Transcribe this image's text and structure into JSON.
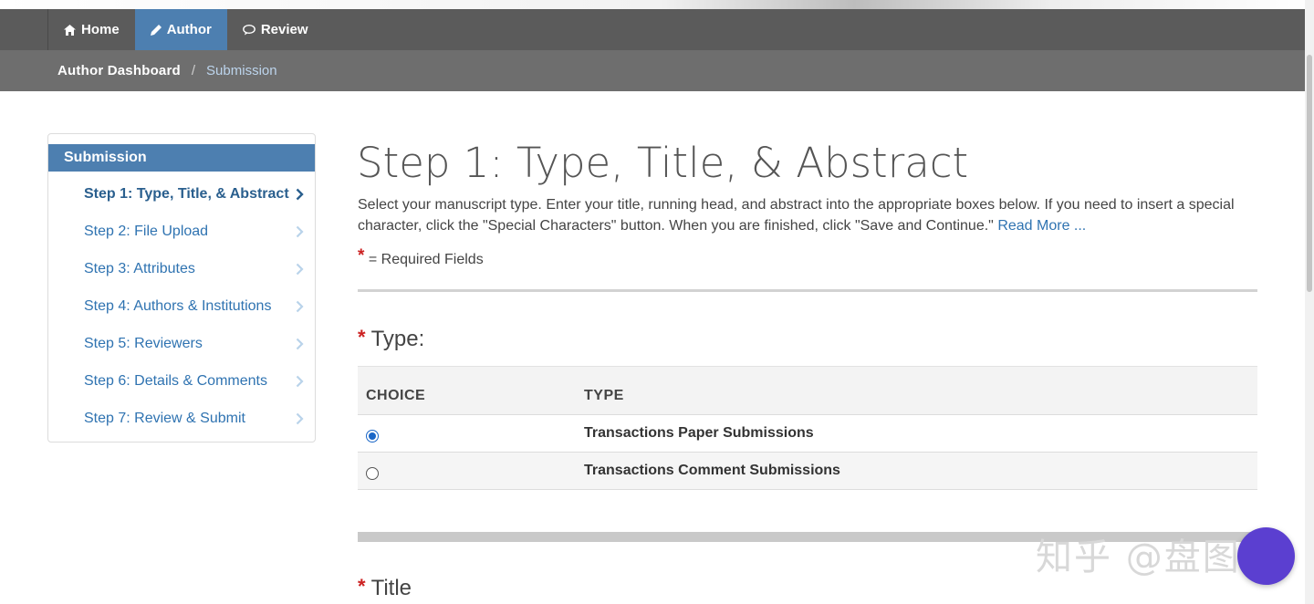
{
  "nav": {
    "items": [
      {
        "label": "Home",
        "icon": "home-icon",
        "active": false
      },
      {
        "label": "Author",
        "icon": "pencil-icon",
        "active": true
      },
      {
        "label": "Review",
        "icon": "speech-bubble-icon",
        "active": false
      }
    ]
  },
  "breadcrumb": {
    "parent": "Author Dashboard",
    "separator": "/",
    "current": "Submission"
  },
  "sidebar": {
    "header": "Submission",
    "steps": [
      {
        "label": "Step 1: Type, Title, & Abstract",
        "current": true
      },
      {
        "label": "Step 2: File Upload",
        "current": false
      },
      {
        "label": "Step 3: Attributes",
        "current": false
      },
      {
        "label": "Step 4: Authors & Institutions",
        "current": false
      },
      {
        "label": "Step 5: Reviewers",
        "current": false
      },
      {
        "label": "Step 6: Details & Comments",
        "current": false
      },
      {
        "label": "Step 7: Review & Submit",
        "current": false
      }
    ]
  },
  "main": {
    "title": "Step 1: Type, Title, & Abstract",
    "intro": "Select your manuscript type. Enter your title, running head, and abstract into the appropriate boxes below. If you need to insert a special character, click the \"Special Characters\" button. When you are finished, click \"Save and Continue.\"",
    "read_more": "Read More ...",
    "required_star": "*",
    "required_legend": "= Required Fields",
    "type_section": {
      "label": "Type:",
      "columns": [
        "CHOICE",
        "TYPE"
      ],
      "rows": [
        {
          "type": "Transactions Paper Submissions",
          "selected": true
        },
        {
          "type": "Transactions Comment Submissions",
          "selected": false
        }
      ]
    },
    "title_section_label": "Title"
  },
  "watermark": "知乎 @盘图庚",
  "colors": {
    "navbar": "#5b5b5b",
    "breadcrumb_bar": "#6e6e6e",
    "accent": "#4d7fb0",
    "link": "#2f73b1",
    "required": "#cc2222",
    "fab": "#5b3fd0"
  }
}
